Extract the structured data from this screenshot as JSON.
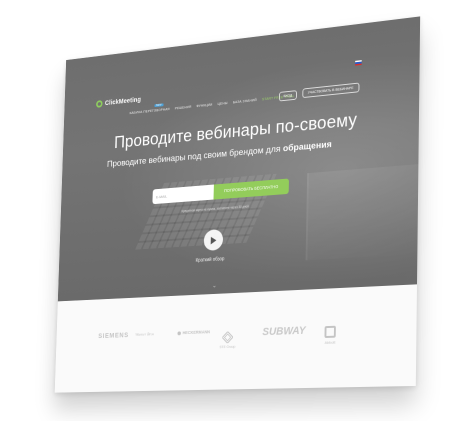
{
  "header": {
    "logo_text": "ClickMeeting",
    "nav_items": [
      {
        "label": "КАБИНА ПЕРЕГОВОРНАЯ",
        "badge": "NEW"
      },
      {
        "label": "РЕШЕНИЯ"
      },
      {
        "label": "ФУНКЦИИ"
      },
      {
        "label": "ЦЕНЫ"
      },
      {
        "label": "БАЗА ЗНАНИЙ"
      },
      {
        "label": "START FREE TRIAL"
      }
    ],
    "login_label": "ВХОД",
    "join_label": "УЧАСТВОВАТЬ В ВЕБИНАРЕ",
    "language_flag": "russia-flag-icon"
  },
  "hero": {
    "headline": "Проводите вебинары по-своему",
    "subline": "Проводите вебинары под своим брендом для",
    "subline_emphasis": "обращения",
    "email_placeholder": "E-MAIL",
    "cta_label": "ПОПРОБОВАТЬ БЕСПЛАТНО",
    "form_note": "Кредитная карта не нужна, заплатите через 30 дней",
    "play_label": "Краткий обзор"
  },
  "clients": {
    "logos": [
      "SIEMENS",
      "Warner Bros",
      "HECKERMANN",
      "STE Group",
      "SUBWAY",
      "Abbott"
    ]
  },
  "colors": {
    "accent": "#93cd5b",
    "hero_overlay": "#6b6b6b",
    "logo_gray": "#c4c4c4"
  }
}
